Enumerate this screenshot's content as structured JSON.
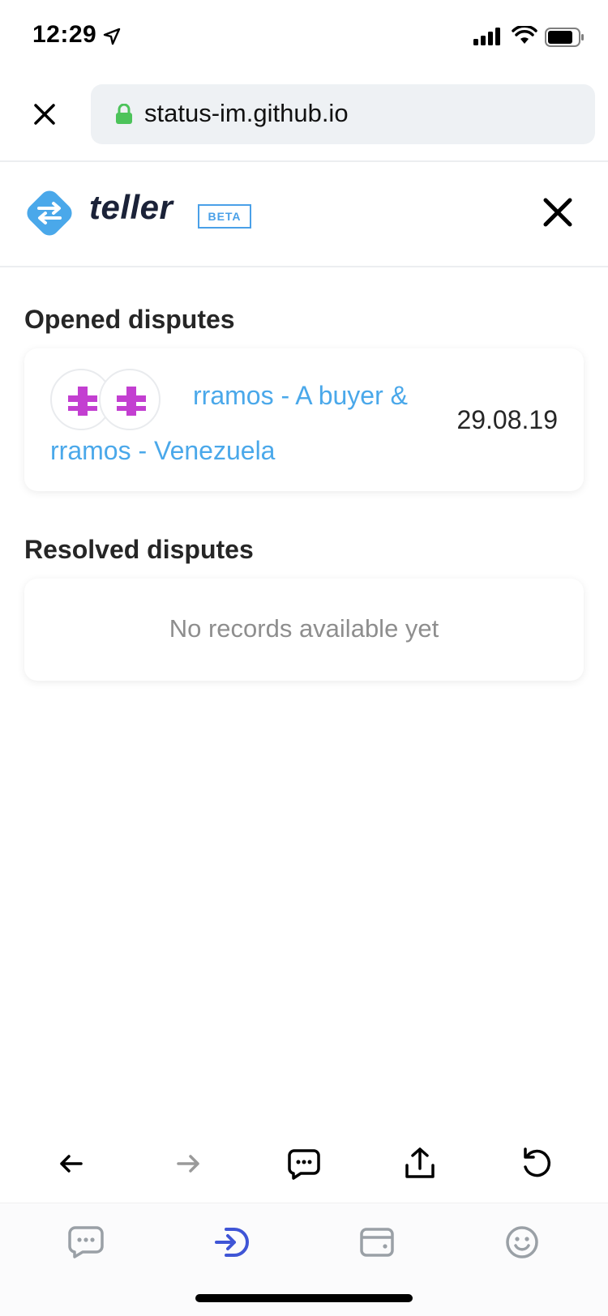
{
  "status_bar": {
    "time": "12:29"
  },
  "browser": {
    "url": "status-im.github.io"
  },
  "app": {
    "name": "teller",
    "badge": "BETA"
  },
  "opened": {
    "title": "Opened disputes",
    "items": [
      {
        "line1": "rramos - A buyer &",
        "line2": "rramos - Venezuela",
        "date": "29.08.19"
      }
    ]
  },
  "resolved": {
    "title": "Resolved disputes",
    "empty_text": "No records available yet"
  },
  "colors": {
    "accent": "#4aa8ea",
    "avatar_glyph": "#c33fd1",
    "lock": "#4cc35a",
    "active_tab": "#3f55d6",
    "inactive_tab": "#9aa0a6"
  },
  "icons": {
    "toolbar": [
      "back-arrow-icon",
      "forward-arrow-icon",
      "chat-icon",
      "share-icon",
      "reload-icon"
    ],
    "tabs": [
      "chat-tab-icon",
      "browser-tab-icon",
      "wallet-tab-icon",
      "profile-tab-icon"
    ]
  }
}
